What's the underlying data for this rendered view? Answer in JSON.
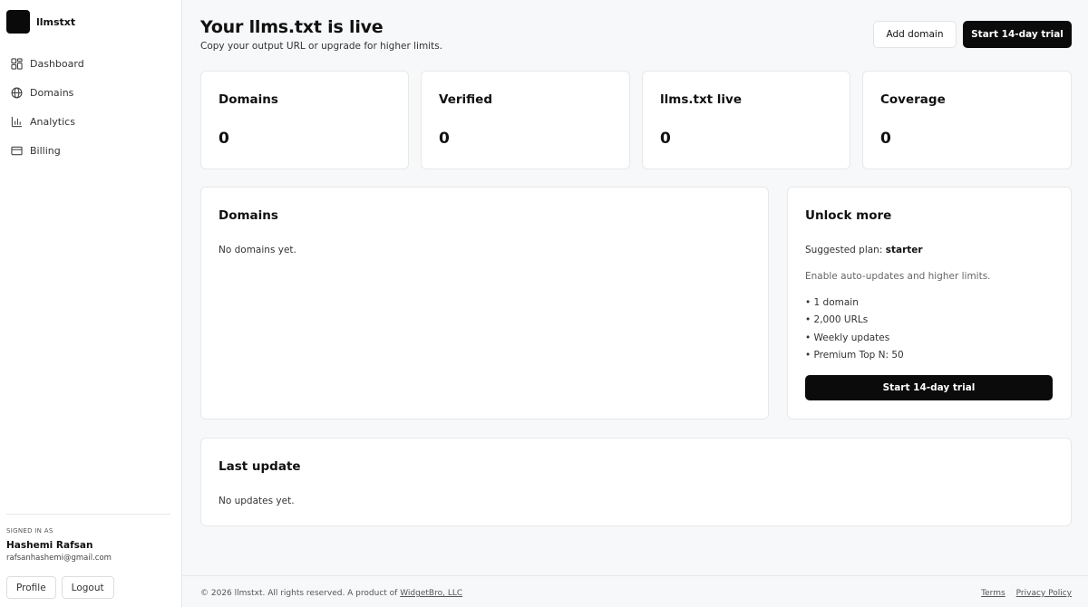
{
  "brand": {
    "name": "llmstxt"
  },
  "sidebar": {
    "items": [
      {
        "label": "Dashboard",
        "icon": "dashboard-grid-icon"
      },
      {
        "label": "Domains",
        "icon": "globe-icon"
      },
      {
        "label": "Analytics",
        "icon": "bar-chart-icon"
      },
      {
        "label": "Billing",
        "icon": "credit-card-icon"
      }
    ],
    "signed_in_label": "SIGNED IN AS",
    "user_name": "Hashemi Rafsan",
    "user_email": "rafsanhashemi@gmail.com",
    "profile_label": "Profile",
    "logout_label": "Logout"
  },
  "header": {
    "title": "Your llms.txt is live",
    "subtitle": "Copy your output URL or upgrade for higher limits.",
    "add_domain_label": "Add domain",
    "trial_label": "Start 14-day trial"
  },
  "stats": [
    {
      "label": "Domains",
      "value": "0"
    },
    {
      "label": "Verified",
      "value": "0"
    },
    {
      "label": "llms.txt live",
      "value": "0"
    },
    {
      "label": "Coverage",
      "value": "0"
    }
  ],
  "domains_card": {
    "title": "Domains",
    "empty_text": "No domains yet."
  },
  "unlock": {
    "title": "Unlock more",
    "suggested_prefix": "Suggested plan:",
    "suggested_plan": "starter",
    "description": "Enable auto-updates and higher limits.",
    "features": [
      "• 1 domain",
      "• 2,000 URLs",
      "• Weekly updates",
      "• Premium Top N: 50"
    ],
    "cta_label": "Start 14-day trial"
  },
  "last_update": {
    "title": "Last update",
    "empty_text": "No updates yet."
  },
  "footer": {
    "copyright": "© 2026 llmstxt. All rights reserved. A product of",
    "company_link": "WidgetBro, LLC",
    "terms": "Terms",
    "privacy": "Privacy Policy"
  }
}
